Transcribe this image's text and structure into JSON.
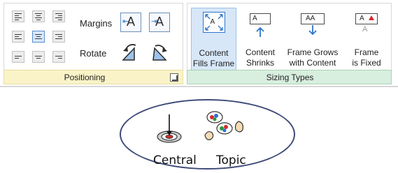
{
  "ribbon": {
    "positioning": {
      "margins_label": "Margins",
      "rotate_label": "Rotate",
      "group_label": "Positioning",
      "margin_icon_text_a": "A",
      "margin_icon_text_b": "A"
    },
    "sizing": {
      "group_label": "Sizing Types",
      "buttons": [
        {
          "line1": "Content",
          "line2": "Fills Frame",
          "icon_text": "A",
          "selected": true
        },
        {
          "line1": "Content",
          "line2": "Shrinks",
          "icon_text": "A",
          "selected": false
        },
        {
          "line1": "Frame Grows",
          "line2": "with Content",
          "icon_text": "AA",
          "selected": false
        },
        {
          "line1": "Frame",
          "line2": "is Fixed",
          "icon_text": "A",
          "icon_text_2": "A",
          "selected": false
        }
      ]
    }
  },
  "canvas": {
    "topic_words": [
      "Central",
      "Topic"
    ]
  },
  "colors": {
    "positioning_footer": "#faf3c8",
    "sizing_footer": "#d8eedf",
    "selected_button": "#d7e7f8",
    "icon_blue": "#2e74c9",
    "bubble_border": "#3e4b78"
  }
}
